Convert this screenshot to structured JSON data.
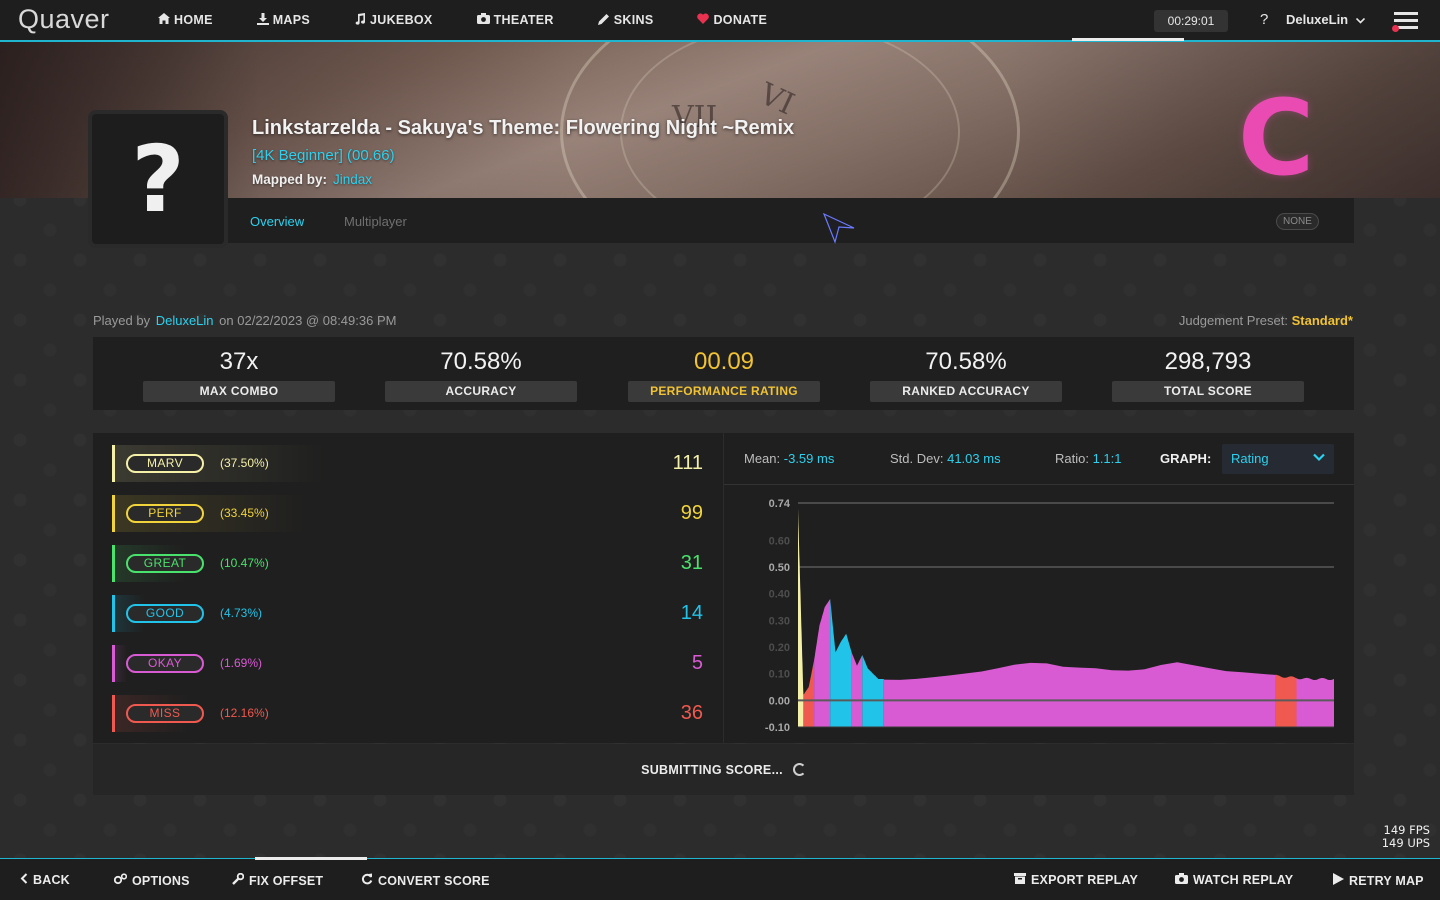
{
  "app": {
    "logo_text": "Quaver"
  },
  "nav": {
    "items": [
      {
        "label": "HOME",
        "icon": "home-icon"
      },
      {
        "label": "MAPS",
        "icon": "download-icon"
      },
      {
        "label": "JUKEBOX",
        "icon": "music-note-icon"
      },
      {
        "label": "THEATER",
        "icon": "camera-icon"
      },
      {
        "label": "SKINS",
        "icon": "pencil-icon"
      },
      {
        "label": "DONATE",
        "icon": "heart-icon"
      }
    ],
    "timer": "00:29:01",
    "help": "?",
    "username": "DeluxeLin"
  },
  "song": {
    "title": "Linkstarzelda - Sakuya's Theme: Flowering Night ~Remix",
    "difficulty": "[4K Beginner] (00.66)",
    "mapped_by_label": "Mapped by:",
    "mapper": "Jindax",
    "thumbnail_placeholder": "?",
    "grade": "C",
    "grade_color": "#ea4bb2"
  },
  "tabs": {
    "overview": "Overview",
    "multiplayer": "Multiplayer",
    "mods": "NONE"
  },
  "played": {
    "prefix": "Played by",
    "player": "DeluxeLin",
    "date": "on 02/22/2023 @ 08:49:36 PM",
    "judgement_label": "Judgement Preset:",
    "judgement_value": "Standard*"
  },
  "stats": [
    {
      "value": "37x",
      "label": "MAX COMBO"
    },
    {
      "value": "70.58%",
      "label": "ACCURACY"
    },
    {
      "value": "00.09",
      "label": "PERFORMANCE RATING"
    },
    {
      "value": "70.58%",
      "label": "RANKED ACCURACY"
    },
    {
      "value": "298,793",
      "label": "TOTAL SCORE"
    }
  ],
  "judgements": [
    {
      "name": "MARV",
      "percent": "(37.50%)",
      "count": "111",
      "color": "#f5f0a8"
    },
    {
      "name": "PERF",
      "percent": "(33.45%)",
      "count": "99",
      "color": "#f1d33b"
    },
    {
      "name": "GREAT",
      "percent": "(10.47%)",
      "count": "31",
      "color": "#49e26c"
    },
    {
      "name": "GOOD",
      "percent": "(4.73%)",
      "count": "14",
      "color": "#22c3e8"
    },
    {
      "name": "OKAY",
      "percent": "(1.69%)",
      "count": "5",
      "color": "#d85bd3"
    },
    {
      "name": "MISS",
      "percent": "(12.16%)",
      "count": "36",
      "color": "#f0594f"
    }
  ],
  "graph": {
    "mean_label": "Mean:",
    "mean_value": "-3.59 ms",
    "std_label": "Std. Dev:",
    "std_value": "41.03 ms",
    "ratio_label": "Ratio:",
    "ratio_value": "1.1:1",
    "graph_label": "GRAPH:",
    "graph_select": "Rating"
  },
  "chart_data": {
    "type": "area",
    "title": "",
    "xlabel": "",
    "ylabel": "",
    "ylim": [
      -0.1,
      0.74
    ],
    "yticks": [
      "0.74",
      "0.60",
      "0.50",
      "0.40",
      "0.30",
      "0.20",
      "0.10",
      "0.00",
      "-0.10"
    ],
    "ytick_values": [
      0.74,
      0.6,
      0.5,
      0.4,
      0.3,
      0.2,
      0.1,
      0.0,
      -0.1
    ],
    "grid": true,
    "x": [
      0,
      0.01,
      0.02,
      0.03,
      0.04,
      0.05,
      0.06,
      0.07,
      0.08,
      0.09,
      0.1,
      0.11,
      0.12,
      0.13,
      0.14,
      0.15,
      0.2,
      0.25,
      0.3,
      0.35,
      0.4,
      0.45,
      0.5,
      0.55,
      0.6,
      0.65,
      0.7,
      0.75,
      0.8,
      0.85,
      0.9,
      0.95,
      1.0
    ],
    "values": [
      0.72,
      0.02,
      0.05,
      0.15,
      0.28,
      0.35,
      0.38,
      0.18,
      0.22,
      0.25,
      0.18,
      0.13,
      0.17,
      0.12,
      0.1,
      0.08,
      0.08,
      0.09,
      0.1,
      0.11,
      0.13,
      0.14,
      0.12,
      0.12,
      0.11,
      0.12,
      0.15,
      0.13,
      0.11,
      0.1,
      0.09,
      0.08,
      0.08
    ],
    "segment_colors": [
      {
        "from": 0.0,
        "to": 0.01,
        "color": "#f5f0a8"
      },
      {
        "from": 0.01,
        "to": 0.03,
        "color": "#f0594f"
      },
      {
        "from": 0.03,
        "to": 0.06,
        "color": "#d85bd3"
      },
      {
        "from": 0.06,
        "to": 0.1,
        "color": "#22c3e8"
      },
      {
        "from": 0.1,
        "to": 0.12,
        "color": "#d85bd3"
      },
      {
        "from": 0.12,
        "to": 0.16,
        "color": "#22c3e8"
      },
      {
        "from": 0.16,
        "to": 0.89,
        "color": "#d85bd3"
      },
      {
        "from": 0.89,
        "to": 0.93,
        "color": "#f0594f"
      },
      {
        "from": 0.93,
        "to": 1.0,
        "color": "#d85bd3"
      }
    ]
  },
  "submit": {
    "text": "SUBMITTING SCORE..."
  },
  "fps": {
    "fps": "149 FPS",
    "ups": "149 UPS"
  },
  "bottom": {
    "back": "BACK",
    "options": "OPTIONS",
    "fix_offset": "FIX OFFSET",
    "convert_score": "CONVERT SCORE",
    "export_replay": "EXPORT REPLAY",
    "watch_replay": "WATCH REPLAY",
    "retry_map": "RETRY MAP"
  },
  "colors": {
    "accent": "#1fb5cf",
    "link": "#2bd1ee",
    "gold": "#f1c232"
  }
}
